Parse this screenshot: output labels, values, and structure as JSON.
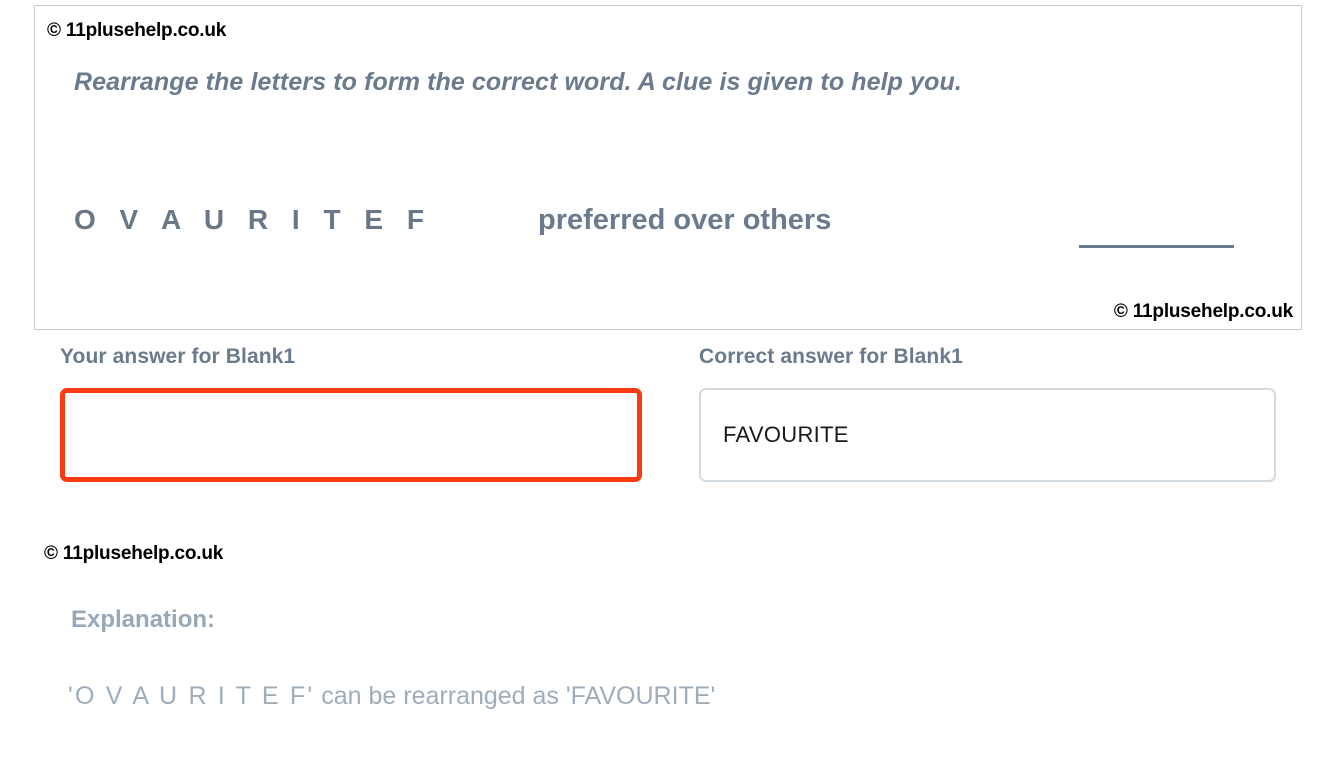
{
  "branding": {
    "copyright": "© 11plusehelp.co.uk"
  },
  "question_card": {
    "copyright_top": "© 11plusehelp.co.uk",
    "copyright_bottom": "© 11plusehelp.co.uk",
    "instruction": "Rearrange the letters to form the correct word. A clue is given to help you.",
    "scrambled_letters": "O V A U R I T E F",
    "clue": "preferred over others",
    "blank_line_label": "answer-blank-line"
  },
  "answers": {
    "user": {
      "label": "Your answer for Blank1",
      "value": "",
      "placeholder": "",
      "border_color": "#f93a13"
    },
    "correct": {
      "label": "Correct answer for Blank1",
      "value": "FAVOURITE",
      "border_color": "#d3dae0"
    }
  },
  "explanation": {
    "copyright": "© 11plusehelp.co.uk",
    "heading": "Explanation:",
    "scrambled_quoted": "'O V A U R I T E F'",
    "middle_text": "  can be rearranged as  ",
    "answer_quoted": "'FAVOURITE'",
    "full_text": "'O V A U R I T E F'  can be rearranged as 'FAVOURITE'"
  },
  "colors": {
    "slate_text": "#6b7a8c",
    "light_slate_text": "#9aa8b5",
    "error_border": "#f93a13",
    "card_border": "#c9c9c9",
    "input_border": "#d3dae0"
  }
}
